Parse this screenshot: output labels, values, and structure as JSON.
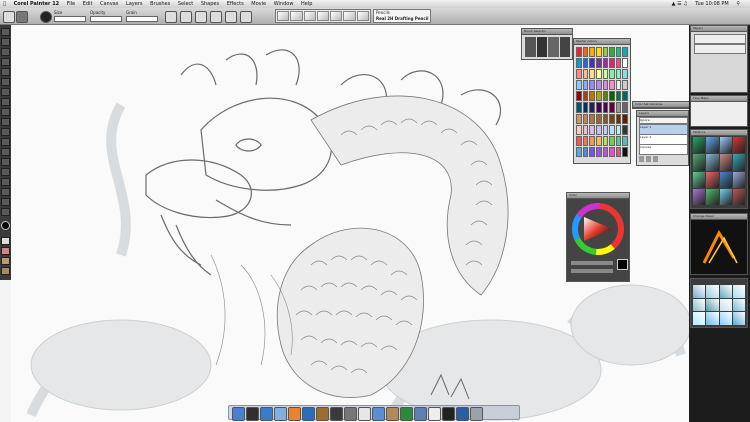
{
  "menubar": {
    "app": "Corel Painter 12",
    "items": [
      "File",
      "Edit",
      "Canvas",
      "Layers",
      "Brushes",
      "Select",
      "Shapes",
      "Effects",
      "Movie",
      "Window",
      "Help"
    ],
    "clock": "Tue 10:08 PM"
  },
  "propbar": {
    "size_label": "Size",
    "opacity_label": "Opacity",
    "grain_label": "Grain",
    "brush_category": "Pencils",
    "brush_variant": "Real 2H Drafting Pencil"
  },
  "panels": {
    "brush_selector": "Brush Selector",
    "mixer": "Mixer",
    "painter_colors": "Painter Colors",
    "color_set_libraries": "Color Set Libraries",
    "layers": {
      "title": "Layers",
      "items": [
        "Layer 1",
        "Layer 2",
        "Canvas"
      ],
      "blend_mode": "Ignore"
    },
    "color": "Color",
    "papers": "Papers",
    "patterns": "Patterns",
    "flow_maps": "Flow Maps",
    "change_papers": "Change Paper"
  },
  "dock": {
    "icons": [
      "finder-icon",
      "dashboard-icon",
      "safari-icon",
      "itunes-icon",
      "illustrator-icon",
      "photoshop-icon",
      "bridge-icon",
      "painter-icon",
      "system-preferences-icon",
      "calendar-icon",
      "mail-icon",
      "address-book-icon",
      "ichat-icon",
      "preview-icon",
      "textedit-icon",
      "x11-icon",
      "word-icon",
      "trash-icon"
    ],
    "colors": [
      "#4a7fd1",
      "#2f2f2f",
      "#3b7cc9",
      "#7fb0e0",
      "#e9842d",
      "#2a6eb8",
      "#9c6b2f",
      "#3a3a3a",
      "#777777",
      "#e6e6e6",
      "#5a8fd6",
      "#b08a5a",
      "#2d8a3c",
      "#5c7fb5",
      "#eeeeee",
      "#222222",
      "#2b5ca8",
      "#9aa3ad"
    ]
  },
  "colors": {
    "menubar_bg": "#e6e6e6",
    "toolbox_bg": "#3a3a3a",
    "canvas_bg": "#fafafa",
    "accent": "#c44"
  }
}
